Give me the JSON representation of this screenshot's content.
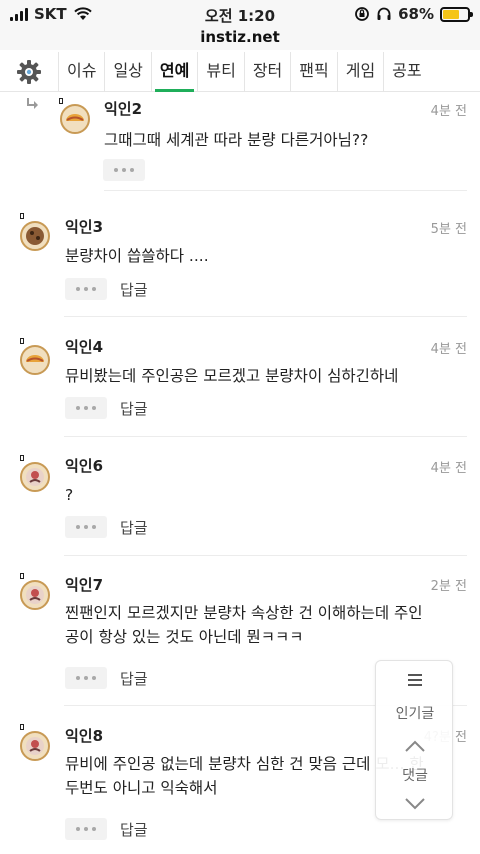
{
  "status_bar": {
    "carrier": "SKT",
    "time": "오전 1:20",
    "battery_percent": "68%",
    "battery_level": 0.68,
    "icons": [
      "signal-icon",
      "wifi-icon",
      "orientation-lock-icon",
      "headphones-icon",
      "battery-icon"
    ]
  },
  "browser": {
    "url": "instiz.net"
  },
  "nav": {
    "settings_icon": "gear-icon",
    "tabs": [
      {
        "label": "이슈"
      },
      {
        "label": "일상"
      },
      {
        "label": "연예",
        "active": true
      },
      {
        "label": "뷰티"
      },
      {
        "label": "장터"
      },
      {
        "label": "팬픽"
      },
      {
        "label": "게임"
      },
      {
        "label": "공포"
      }
    ],
    "active_color": "#1fae5a"
  },
  "comments": [
    {
      "nick": "익인2",
      "time": "4분 전",
      "body": "그때그때 세계관 따라 분량 다른거아님??",
      "is_reply": true,
      "avatar": "taco-avatar"
    },
    {
      "nick": "익인3",
      "time": "5분 전",
      "body": "분량차이 씁쓸하다 ....",
      "reply_label": "답글",
      "avatar": "cookie-avatar"
    },
    {
      "nick": "익인4",
      "time": "4분 전",
      "body": "뮤비봤는데 주인공은 모르겠고 분량차이 심하긴하네",
      "reply_label": "답글",
      "avatar": "taco-avatar"
    },
    {
      "nick": "익인6",
      "time": "4분 전",
      "body": "?",
      "reply_label": "답글",
      "avatar": "chick-avatar"
    },
    {
      "nick": "익인7",
      "time": "2분 전",
      "body": "찐팬인지 모르겠지만 분량차 속상한 건 이해하는데 주인\n공이 항상 있는 것도 아닌데 뭔ㅋㅋㅋ",
      "reply_label": "답글",
      "avatar": "chick-avatar"
    },
    {
      "nick": "익인8",
      "time": "4?분 전",
      "body": "뮤비에 주인공 없는데 분량차 심한 건 맞음 근데 모... 한\n두번도 아니고 익숙해서",
      "reply_label": "답글",
      "avatar": "chick-avatar"
    }
  ],
  "float_panel": {
    "menu_icon": "hamburger-icon",
    "popular_label": "인기글",
    "up_icon": "chevron-up-icon",
    "comments_label": "댓글",
    "down_icon": "chevron-down-icon"
  }
}
